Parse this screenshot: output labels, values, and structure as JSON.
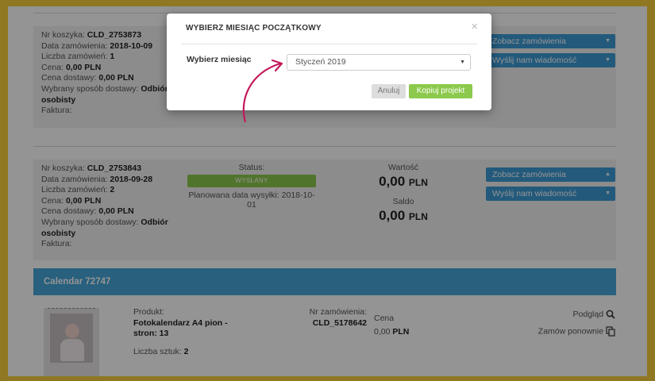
{
  "orders": [
    {
      "cart_label": "Nr koszyka:",
      "cart_value": "CLD_2753873",
      "date_label": "Data zamówienia:",
      "date_value": "2018-10-09",
      "count_label": "Liczba zamówień:",
      "count_value": "1",
      "price_label": "Cena:",
      "price_value": "0,00 PLN",
      "delivery_label": "Cena dostawy:",
      "delivery_value": "0,00 PLN",
      "shipping_label": "Wybrany sposób dostawy:",
      "shipping_value": "Odbiór osobisty",
      "invoice_label": "Faktura:",
      "btn_orders": "Zobacz zamówienia",
      "btn_message": "Wyślij nam wiadomość"
    },
    {
      "cart_label": "Nr koszyka:",
      "cart_value": "CLD_2753843",
      "date_label": "Data zamówienia:",
      "date_value": "2018-09-28",
      "count_label": "Liczba zamówień:",
      "count_value": "2",
      "price_label": "Cena:",
      "price_value": "0,00 PLN",
      "delivery_label": "Cena dostawy:",
      "delivery_value": "0,00 PLN",
      "shipping_label": "Wybrany sposób dostawy:",
      "shipping_value": "Odbiór osobisty",
      "invoice_label": "Faktura:",
      "status_label": "Status:",
      "status_value": "WYSŁANY",
      "planned_label": "Planowana data wysyłki: 2018-10-01",
      "value_label": "Wartość",
      "value_amount": "0,00",
      "value_currency": "PLN",
      "saldo_label": "Saldo",
      "saldo_amount": "0,00",
      "saldo_currency": "PLN",
      "btn_orders": "Zobacz zamówienia",
      "btn_message": "Wyślij nam wiadomość"
    }
  ],
  "calendar": {
    "header": "Calendar 72747",
    "product_label": "Produkt:",
    "product_value": "Fotokalendarz A4 pion - stron: 13",
    "qty_label": "Liczba sztuk:",
    "qty_value": "2",
    "order_no_label": "Nr zamówienia:",
    "order_no_value": "CLD_5178642",
    "price_label": "Cena",
    "price_value": "0,00",
    "price_currency": "PLN",
    "preview_label": "Podgląd",
    "reorder_label": "Zamów ponownie"
  },
  "modal": {
    "title": "WYBIERZ MIESIĄC POCZĄTKOWY",
    "close_glyph": "×",
    "field_label": "Wybierz miesiąc",
    "selected_month": "Styczeń 2019",
    "cancel_label": "Anuluj",
    "copy_label": "Kopiuj projekt"
  },
  "colors": {
    "frame": "#f6cf3a",
    "accent_blue": "#3d9bd6",
    "status_green": "#8cc94c",
    "arrow": "#c2185b"
  }
}
